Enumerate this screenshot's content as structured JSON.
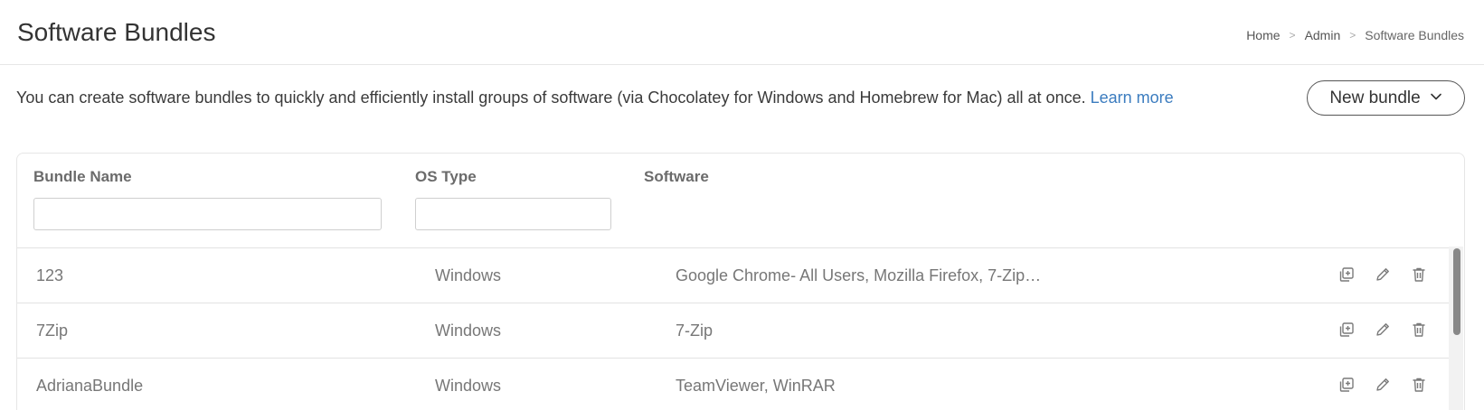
{
  "header": {
    "title": "Software Bundles",
    "breadcrumb": [
      {
        "label": "Home"
      },
      {
        "label": "Admin"
      },
      {
        "label": "Software Bundles"
      }
    ],
    "separator": ">"
  },
  "description": {
    "text": "You can create software bundles to quickly and efficiently install groups of software (via Chocolatey for Windows and Homebrew for Mac) all at once.",
    "link_label": "Learn more"
  },
  "new_bundle_button": {
    "label": "New bundle",
    "icon": "chevron-down-icon"
  },
  "table": {
    "columns": {
      "name": "Bundle Name",
      "os": "OS Type",
      "software": "Software"
    },
    "filters": {
      "name_value": "",
      "os_value": ""
    },
    "rows": [
      {
        "name": "123",
        "os": "Windows",
        "software": "Google Chrome- All Users, Mozilla Firefox, 7-Zip…"
      },
      {
        "name": "7Zip",
        "os": "Windows",
        "software": "7-Zip"
      },
      {
        "name": "AdrianaBundle",
        "os": "Windows",
        "software": "TeamViewer, WinRAR"
      }
    ],
    "row_actions": [
      "duplicate-icon",
      "edit-icon",
      "delete-icon"
    ]
  },
  "colors": {
    "link": "#3b7cbf",
    "icon": "#7a7a7a",
    "border": "#e2e2e2"
  }
}
